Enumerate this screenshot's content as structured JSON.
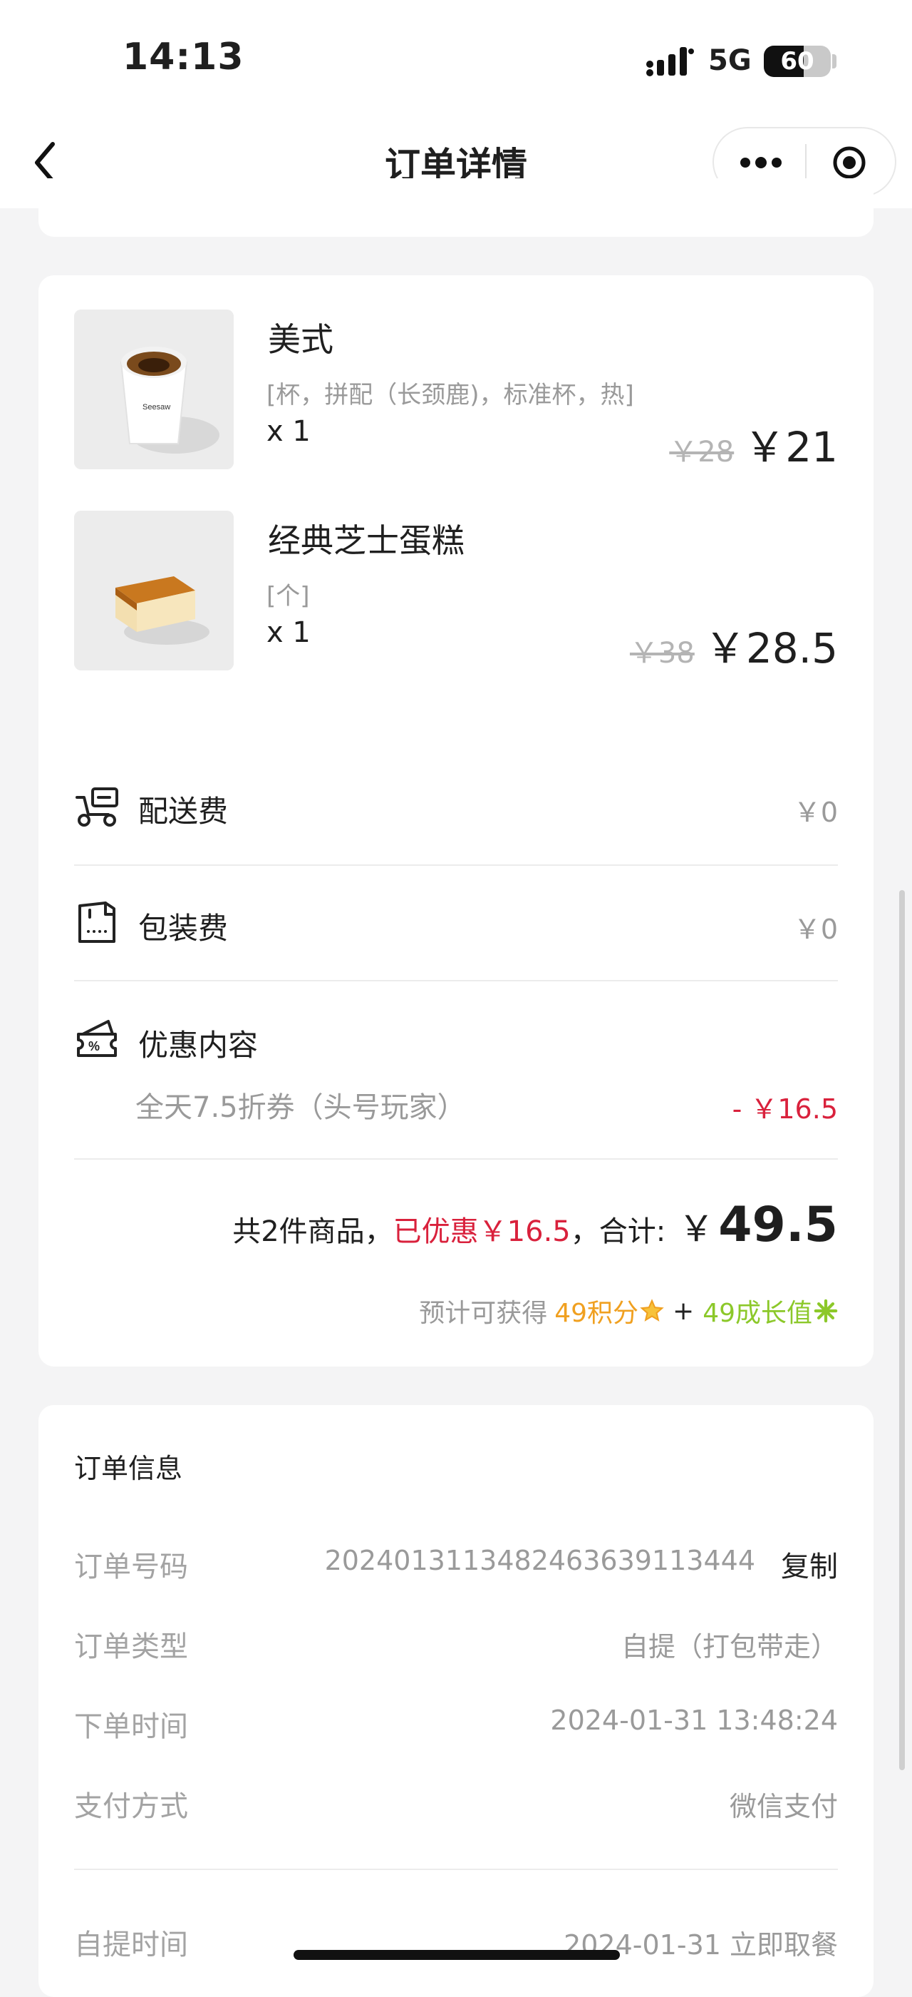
{
  "status_bar": {
    "time": "14:13",
    "network": "5G",
    "battery": "60",
    "battery_level": 0.6
  },
  "nav": {
    "title": "订单详情"
  },
  "products": [
    {
      "name": "美式",
      "spec": "[杯，拼配（长颈鹿)，标准杯，热]",
      "qty": "x 1",
      "original_price": "￥28",
      "price": "￥21"
    },
    {
      "name": "经典芝士蛋糕",
      "spec": "[个]",
      "qty": "x 1",
      "original_price": "￥38",
      "price": "￥28.5"
    }
  ],
  "fees": {
    "delivery": {
      "label": "配送费",
      "value": "￥0"
    },
    "packing": {
      "label": "包装费",
      "value": "￥0"
    },
    "discount": {
      "label": "优惠内容",
      "item": "全天7.5折券（头号玩家）",
      "value": "- ￥16.5"
    }
  },
  "summary": {
    "count_text": "共2件商品，",
    "discounted_text": "已优惠￥16.5",
    "total_label": "，合计:",
    "currency": "￥",
    "total": "49.5",
    "reward_prefix": "预计可获得",
    "points": "49积分",
    "plus": "+",
    "growth": "49成长值"
  },
  "order_info": {
    "title": "订单信息",
    "rows": [
      {
        "label": "订单号码",
        "value": "2024013113482463639113444",
        "action": "复制"
      },
      {
        "label": "订单类型",
        "value": "自提（打包带走）"
      },
      {
        "label": "下单时间",
        "value": "2024-01-31 13:48:24"
      },
      {
        "label": "支付方式",
        "value": "微信支付"
      },
      {
        "label": "自提时间",
        "value": "2024-01-31 立即取餐"
      }
    ]
  },
  "colors": {
    "accent_red": "#d9213c",
    "points_orange": "#f0a020",
    "growth_green": "#8cc82a",
    "page_bg": "#f4f4f5"
  }
}
